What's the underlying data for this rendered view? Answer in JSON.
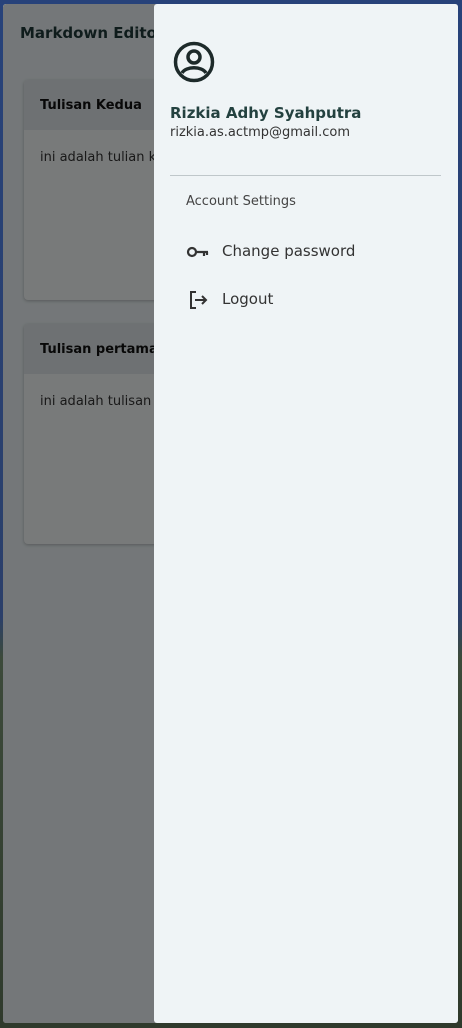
{
  "app": {
    "title": "Markdown Editor"
  },
  "notes": [
    {
      "title": "Tulisan Kedua",
      "preview": "ini adalah tulian kedua"
    },
    {
      "title": "Tulisan pertama",
      "preview": "ini adalah tulisan pertama"
    }
  ],
  "drawer": {
    "icon": "account-circle-icon",
    "user_name": "Rizkia Adhy Syahputra",
    "user_email": "rizkia.as.actmp@gmail.com",
    "section_label": "Account Settings",
    "items": [
      {
        "label": "Change password",
        "icon": "key-icon"
      },
      {
        "label": "Logout",
        "icon": "logout-icon"
      }
    ]
  },
  "colors": {
    "accent": "#23413f",
    "drawer_bg": "#eff4f6",
    "scrim": "rgba(0,0,0,0.5)"
  }
}
